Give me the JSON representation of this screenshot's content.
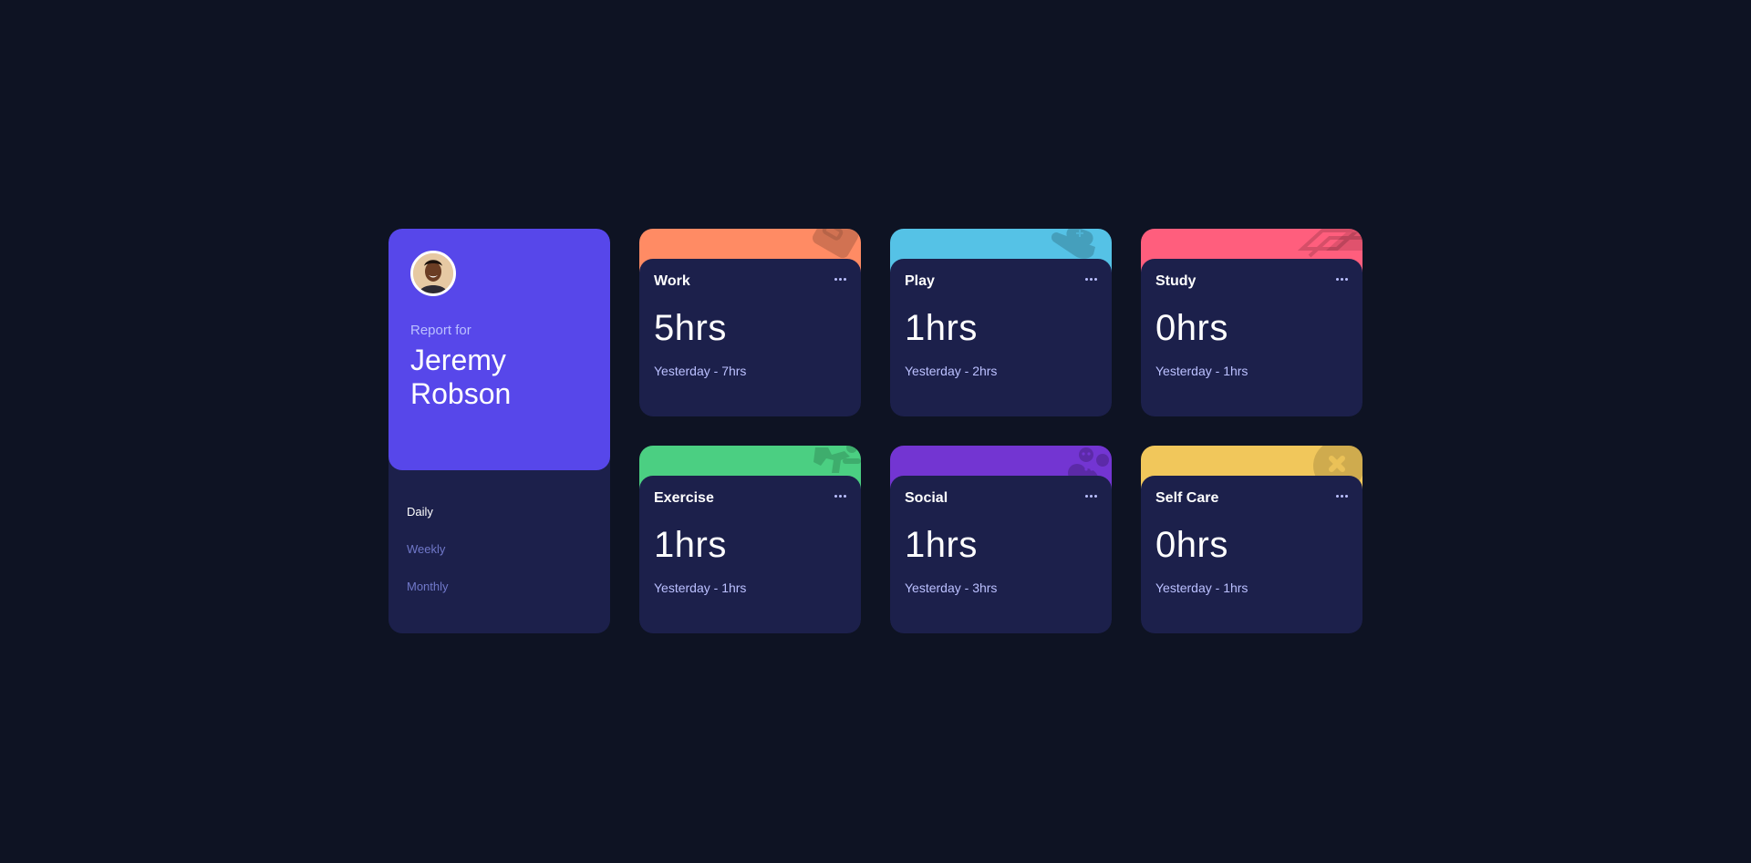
{
  "profile": {
    "report_for": "Report for",
    "name": "Jeremy Robson",
    "avatar_icon": "user-avatar",
    "accent_color": "#5747ea"
  },
  "periods": [
    {
      "label": "Daily",
      "active": true
    },
    {
      "label": "Weekly",
      "active": false
    },
    {
      "label": "Monthly",
      "active": false
    }
  ],
  "activities": [
    {
      "title": "Work",
      "current": "5hrs",
      "previous": "Yesterday - 7hrs",
      "color": "#ff8b64",
      "icon": "briefcase-icon"
    },
    {
      "title": "Play",
      "current": "1hrs",
      "previous": "Yesterday - 2hrs",
      "color": "#55c2e6",
      "icon": "gamepad-icon"
    },
    {
      "title": "Study",
      "current": "0hrs",
      "previous": "Yesterday - 1hrs",
      "color": "#ff5e7d",
      "icon": "book-icon"
    },
    {
      "title": "Exercise",
      "current": "1hrs",
      "previous": "Yesterday - 1hrs",
      "color": "#4bcf82",
      "icon": "running-icon"
    },
    {
      "title": "Social",
      "current": "1hrs",
      "previous": "Yesterday - 3hrs",
      "color": "#7335d2",
      "icon": "social-icon"
    },
    {
      "title": "Self Care",
      "current": "0hrs",
      "previous": "Yesterday - 1hrs",
      "color": "#f1c75b",
      "icon": "self-care-icon"
    }
  ]
}
